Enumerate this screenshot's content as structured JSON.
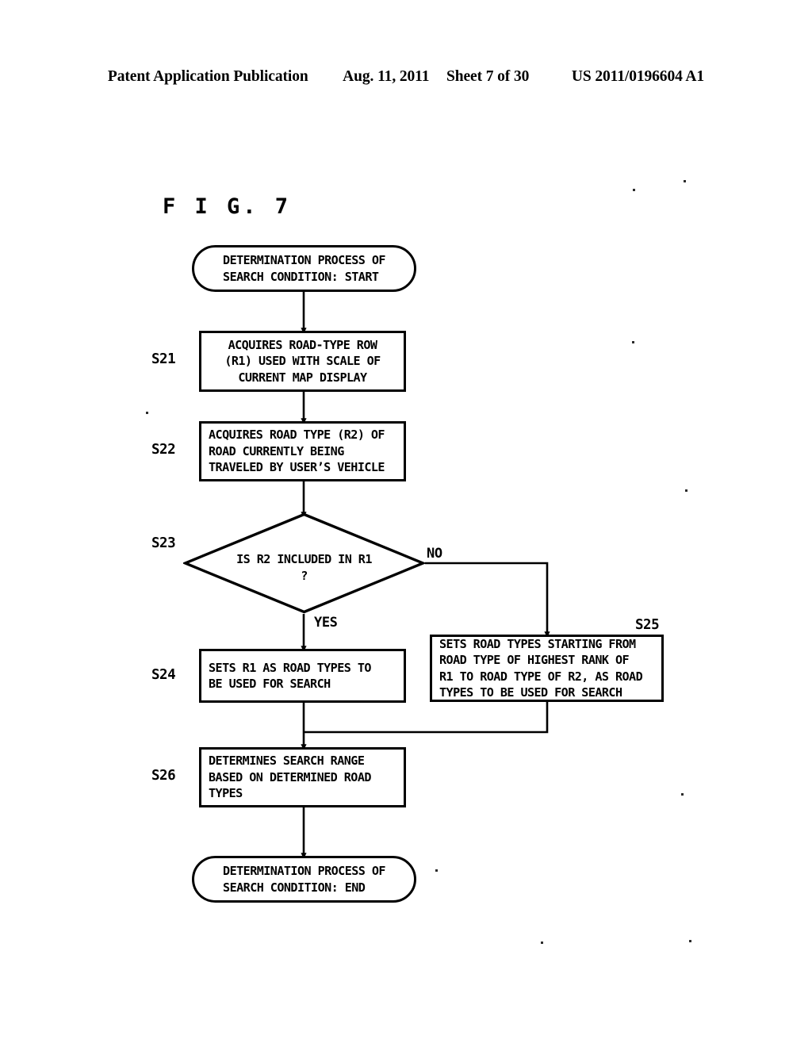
{
  "header": {
    "publication": "Patent Application Publication",
    "date": "Aug. 11, 2011",
    "sheet": "Sheet 7 of 30",
    "patent_number": "US 2011/0196604 A1"
  },
  "figure": {
    "label": "F I G.  7"
  },
  "flowchart": {
    "type": "flowchart",
    "nodes": [
      {
        "id": "start",
        "shape": "terminator",
        "step": "",
        "text": "DETERMINATION PROCESS OF\nSEARCH CONDITION: START"
      },
      {
        "id": "s21",
        "shape": "process",
        "step": "S21",
        "text": "ACQUIRES ROAD-TYPE ROW\n(R1) USED WITH SCALE OF\nCURRENT MAP DISPLAY"
      },
      {
        "id": "s22",
        "shape": "process",
        "step": "S22",
        "text": "ACQUIRES ROAD TYPE (R2) OF\nROAD CURRENTLY BEING\nTRAVELED BY USER’S VEHICLE"
      },
      {
        "id": "s23",
        "shape": "decision",
        "step": "S23",
        "text": "IS R2 INCLUDED IN R1\n?"
      },
      {
        "id": "s24",
        "shape": "process",
        "step": "S24",
        "text": "SETS R1 AS ROAD TYPES TO\nBE USED FOR SEARCH"
      },
      {
        "id": "s25",
        "shape": "process",
        "step": "S25",
        "text": "SETS ROAD TYPES STARTING FROM\nROAD TYPE OF HIGHEST RANK OF\nR1 TO ROAD TYPE OF R2, AS ROAD\nTYPES TO BE USED FOR SEARCH"
      },
      {
        "id": "s26",
        "shape": "process",
        "step": "S26",
        "text": "DETERMINES SEARCH RANGE\nBASED ON DETERMINED ROAD\nTYPES"
      },
      {
        "id": "end",
        "shape": "terminator",
        "step": "",
        "text": "DETERMINATION PROCESS OF\nSEARCH CONDITION: END"
      }
    ],
    "branch_labels": {
      "yes": "YES",
      "no": "NO"
    },
    "edges": [
      {
        "from": "start",
        "to": "s21",
        "label": ""
      },
      {
        "from": "s21",
        "to": "s22",
        "label": ""
      },
      {
        "from": "s22",
        "to": "s23",
        "label": ""
      },
      {
        "from": "s23",
        "to": "s24",
        "label": "YES"
      },
      {
        "from": "s23",
        "to": "s25",
        "label": "NO"
      },
      {
        "from": "s24",
        "to": "s26",
        "label": ""
      },
      {
        "from": "s25",
        "to": "s26",
        "label": ""
      },
      {
        "from": "s26",
        "to": "end",
        "label": ""
      }
    ]
  },
  "style": {
    "line_color": "#000000",
    "background": "#ffffff"
  }
}
